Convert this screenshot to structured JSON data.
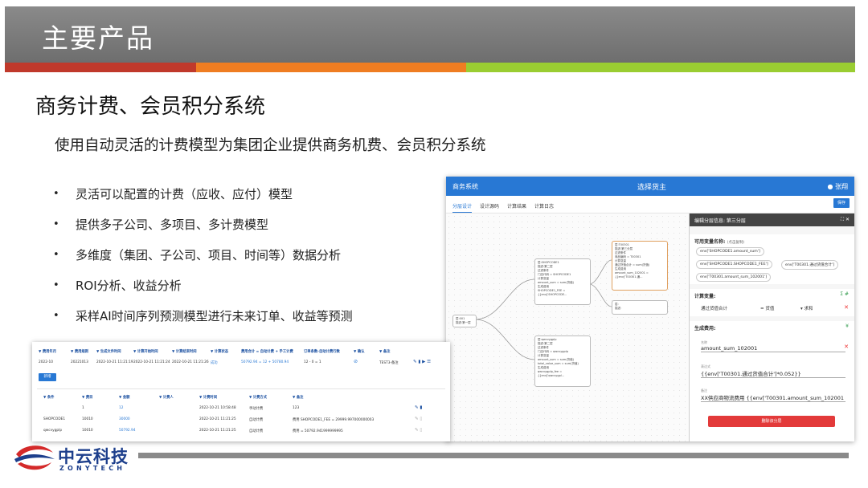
{
  "slide": {
    "title": "主要产品",
    "heading": "商务计费、会员积分系统",
    "subtitle": "使用自动灵活的计费模型为集团企业提供商务机费、会员积分系统",
    "bullets": [
      "灵活可以配置的计费（应收、应付）模型",
      "提供多子公司、多项目、多计费模型",
      "多维度（集团、子公司、项目、时间等）数据分析",
      "ROI分析、收益分析",
      "采样AI时间序列预测模型进行未来订单、收益等预测"
    ],
    "bullet_symbol": "•",
    "stripe_colors": [
      "#c0392b",
      "#ef7d22",
      "#9acd32"
    ]
  },
  "app": {
    "name": "商务系统",
    "center_title": "选择货主",
    "user": "张翔",
    "tabs": [
      "分层设计",
      "设计源码",
      "计算结果",
      "计算日志"
    ],
    "save_label": "保存",
    "nodes": {
      "root": [
        "层:001",
        "描述:第一层"
      ],
      "n2": [
        "层:SHOPCODE1",
        "描述:第二层",
        "",
        "过滤条件",
        "门店代码 = SHOPCODE1",
        "",
        "计算变量",
        "amount_sum = sum(货值)",
        "",
        "生成费用",
        "SHOPCODE1_FEE = {{env['SHOPCODE..."
      ],
      "n3": [
        "层:qwcvygplp",
        "描述:第二层",
        "",
        "过滤条件",
        "门店代码 = qwcvygplp",
        "",
        "计算变量",
        "amount_sum = sum(货值)",
        "total_value_sum = sum(货值)",
        "",
        "生成费用",
        "qwcvygplp_fee = {{env['qwcvygpl..."
      ],
      "n4": [
        "层:T00301",
        "描述:第三分层",
        "",
        "过滤条件",
        "商品编码 = T00301",
        "",
        "计算变量",
        "通过货值合计 = sum(货值)",
        "",
        "生成费用",
        "amount_sum_102001 = {{env['T00301.通..."
      ],
      "n5": [
        "层:",
        "描述:"
      ]
    },
    "panel": {
      "header": "编辑分层信息: 第三分层",
      "header_icons": "⛶ ✕",
      "vars_label": "可用变量名称:",
      "vars_hint": "(点击复制)",
      "chips": [
        "env['SHOPCODE1.amount_sum']",
        "env['SHOPCODE1.SHOPCODE1_FEE']",
        "env['T00301.通过货值合计']",
        "env['T00301.amount_sum_102001']"
      ],
      "calc_label": "计算变量:",
      "calc_row": {
        "name": "通过货值合计",
        "eq": "=",
        "field": "货值",
        "agg": "求和"
      },
      "fee_label": "生成费用:",
      "fields": [
        {
          "k": "名称",
          "v": "amount_sum_102001"
        },
        {
          "k": "表达式",
          "v": "{{env['T00301.通过货值合计']*0.052}}"
        },
        {
          "k": "备注",
          "v": "XX供应商物流费用 {{env['T00301.amount_sum_102001"
        }
      ],
      "delete_label": "删除该分层"
    }
  },
  "table": {
    "headers": [
      "费用年月",
      "费用规则",
      "生成文件时间",
      "计算开始时间",
      "计算结束时间",
      "计算状态",
      "费用合计 = 自动计费 + 手工计费",
      "订单条数-自动计费行数",
      "确认",
      "备注"
    ],
    "row": [
      "2022-10",
      "20221013",
      "2022-10-21 11:21:19",
      "2022-10-21 11:21:24",
      "2022-10-21 11:21:26",
      "成功",
      "50792.94 = 12 + 50780.94",
      "12 - 0 = 1",
      "TEST3-备注"
    ],
    "new_label": "新增",
    "inner_headers": [
      "条件",
      "费目",
      "金额",
      "计费人",
      "计费时间",
      "计费方式",
      "备注"
    ],
    "inner_rows": [
      [
        "",
        "1",
        "12",
        "",
        "2022-10-21 10:58:48",
        "手动计费",
        "123"
      ],
      [
        "SHOPCODE1",
        "10010",
        "30000",
        "",
        "2022-10-21 11:21:25",
        "自动计费",
        "费用 SHOPCODE1_FEE = 29999.997000000003"
      ],
      [
        "qwcvygplp",
        "10010",
        "50792.94",
        "",
        "2022-10-21 11:21:25",
        "自动计费",
        "费用 = 50792.941999999995"
      ]
    ]
  },
  "logo": {
    "cn": "中云科技",
    "en": "ZONYTECH"
  }
}
